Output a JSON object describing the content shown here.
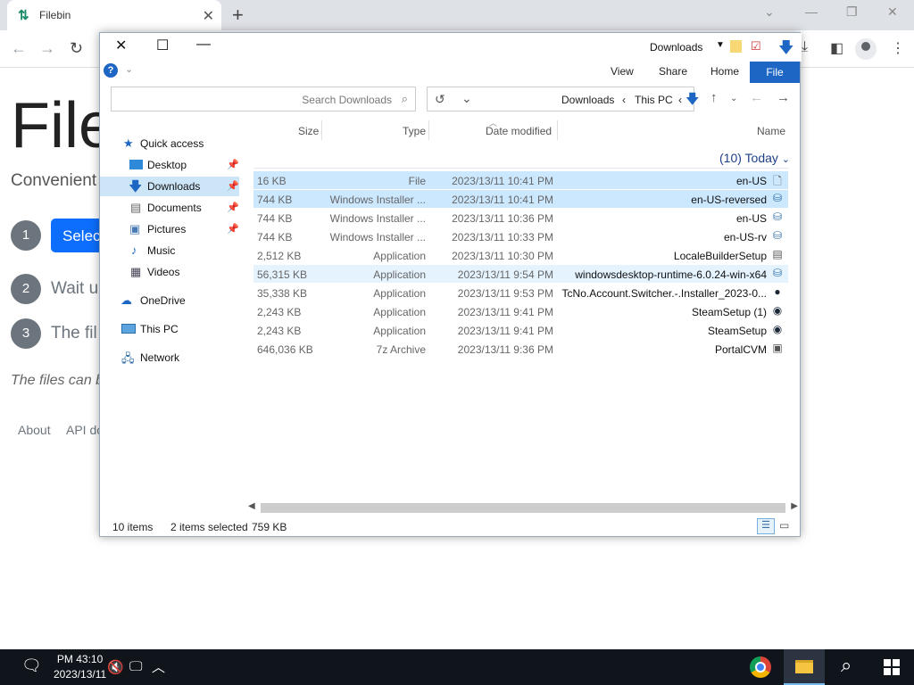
{
  "browser": {
    "tab_title": "Filebin",
    "tab_close": "✕",
    "new_tab": "+"
  },
  "page": {
    "heading": "File",
    "subtitle": "Convenient",
    "select_button": "Selec",
    "steps": [
      {
        "num": "1"
      },
      {
        "num": "2",
        "text": "Wait u"
      },
      {
        "num": "3",
        "text": "The fil"
      }
    ],
    "italic_note": "The files can b",
    "footer_links": [
      "About",
      "API do"
    ]
  },
  "explorer": {
    "title": "Downloads",
    "ribbon_tabs": [
      "View",
      "Share",
      "Home"
    ],
    "ribbon_file": "File",
    "search_placeholder": "Search Downloads",
    "address": {
      "current": "Downloads",
      "parent": "This PC"
    },
    "sidebar": [
      {
        "label": "Quick access"
      },
      {
        "label": "Desktop",
        "pinned": true
      },
      {
        "label": "Downloads",
        "pinned": true,
        "selected": true
      },
      {
        "label": "Documents",
        "pinned": true
      },
      {
        "label": "Pictures",
        "pinned": true
      },
      {
        "label": "Music"
      },
      {
        "label": "Videos"
      },
      {
        "label": "OneDrive"
      },
      {
        "label": "This PC"
      },
      {
        "label": "Network"
      }
    ],
    "columns": {
      "size": "Size",
      "type": "Type",
      "date": "Date modified",
      "name": "Name"
    },
    "group_header": "(10) Today",
    "files": [
      {
        "size": "16 KB",
        "type": "File",
        "date": "2023/13/11 10:41 PM",
        "name": "en-US",
        "icon": "file-icon",
        "selected": true
      },
      {
        "size": "744 KB",
        "type": "Windows Installer ...",
        "date": "2023/13/11 10:41 PM",
        "name": "en-US-reversed",
        "icon": "installer-icon",
        "selected": true
      },
      {
        "size": "744 KB",
        "type": "Windows Installer ...",
        "date": "2023/13/11 10:36 PM",
        "name": "en-US",
        "icon": "installer-icon"
      },
      {
        "size": "744 KB",
        "type": "Windows Installer ...",
        "date": "2023/13/11 10:33 PM",
        "name": "en-US-rv",
        "icon": "installer-icon"
      },
      {
        "size": "2,512 KB",
        "type": "Application",
        "date": "2023/13/11 10:30 PM",
        "name": "LocaleBuilderSetup",
        "icon": "app-icon"
      },
      {
        "size": "56,315 KB",
        "type": "Application",
        "date": "2023/13/11 9:54 PM",
        "name": "windowsdesktop-runtime-6.0.24-win-x64",
        "icon": "installer-icon",
        "hover": true
      },
      {
        "size": "35,338 KB",
        "type": "Application",
        "date": "2023/13/11 9:53 PM",
        "name": "TcNo.Account.Switcher.-.Installer_2023-0...",
        "icon": "tcno-icon"
      },
      {
        "size": "2,243 KB",
        "type": "Application",
        "date": "2023/13/11 9:41 PM",
        "name": "SteamSetup (1)",
        "icon": "steam-icon"
      },
      {
        "size": "2,243 KB",
        "type": "Application",
        "date": "2023/13/11 9:41 PM",
        "name": "SteamSetup",
        "icon": "steam-icon"
      },
      {
        "size": "646,036 KB",
        "type": "7z Archive",
        "date": "2023/13/11 9:36 PM",
        "name": "PortalCVM",
        "icon": "archive-icon"
      }
    ],
    "status": {
      "items": "10 items",
      "selected": "2 items selected",
      "selected_size": "759 KB"
    }
  },
  "taskbar": {
    "time": "PM 43:10",
    "date": "2023/13/11"
  }
}
